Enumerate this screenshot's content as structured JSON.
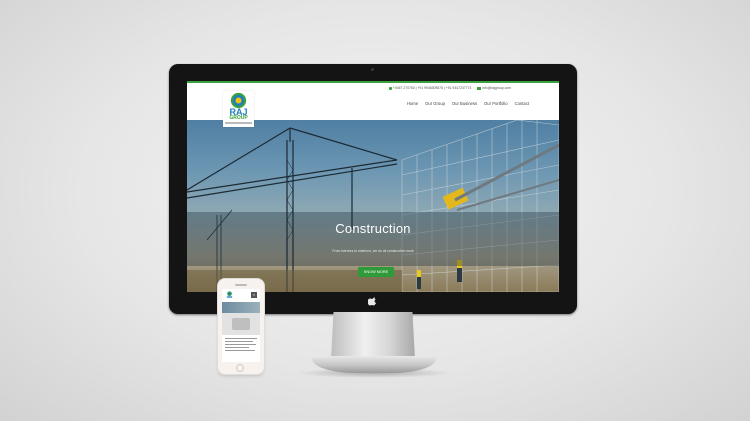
{
  "website": {
    "topbar": {
      "phone_1": "+0467 270760",
      "phone_2": "+91 9946309876",
      "phone_3": "+91 9447237773",
      "email": "info@rajgroup.com"
    },
    "logo": {
      "name": "RAJ",
      "group": "GROUP"
    },
    "nav": [
      "Home",
      "Our Group",
      "Our Business",
      "Our Portfolio",
      "Contact"
    ],
    "hero": {
      "title": "Construction",
      "subtitle": "From interiors to exteriors, we do all construction work",
      "button": "KNOW MORE"
    }
  },
  "colors": {
    "accent_green": "#3aa13c",
    "brand_blue": "#1f7fbf",
    "monitor_bezel": "#141414"
  },
  "icons": [
    "apple-icon",
    "phone-icon",
    "mail-icon",
    "close-icon",
    "sun-logo-icon"
  ]
}
